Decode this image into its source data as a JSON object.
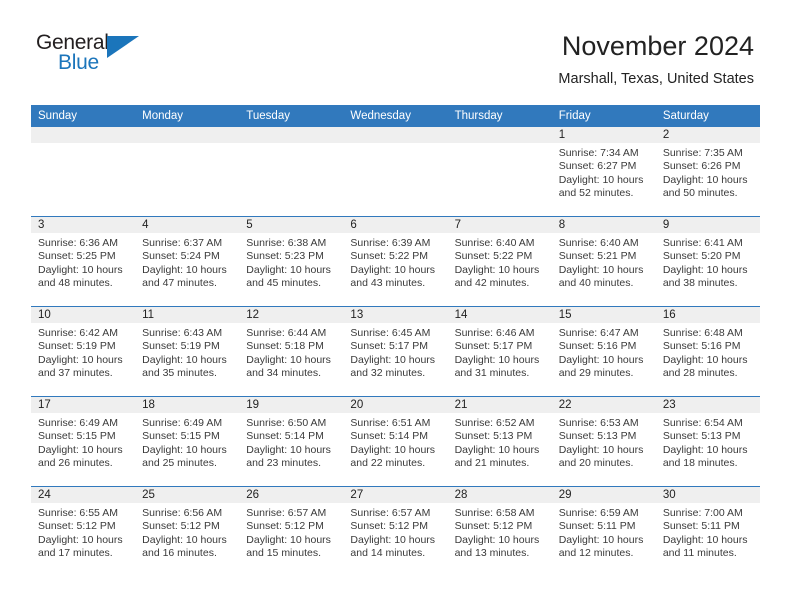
{
  "brand": {
    "name_part1": "General",
    "name_part2": "Blue",
    "mark": "triangle-logo-mark"
  },
  "header": {
    "title": "November 2024",
    "location": "Marshall, Texas, United States"
  },
  "colors": {
    "header_blue": "#3179bd",
    "day_band_gray": "#efefef",
    "brand_blue": "#1b75bb",
    "text": "#222222"
  },
  "weekday_headers": [
    "Sunday",
    "Monday",
    "Tuesday",
    "Wednesday",
    "Thursday",
    "Friday",
    "Saturday"
  ],
  "labels": {
    "sunrise_prefix": "Sunrise:",
    "sunset_prefix": "Sunset:",
    "daylight_prefix": "Daylight:"
  },
  "weeks": [
    [
      {
        "day": "",
        "empty": true
      },
      {
        "day": "",
        "empty": true
      },
      {
        "day": "",
        "empty": true
      },
      {
        "day": "",
        "empty": true
      },
      {
        "day": "",
        "empty": true
      },
      {
        "day": "1",
        "sunrise": "Sunrise: 7:34 AM",
        "sunset": "Sunset: 6:27 PM",
        "daylight_line1": "Daylight: 10 hours",
        "daylight_line2": "and 52 minutes."
      },
      {
        "day": "2",
        "sunrise": "Sunrise: 7:35 AM",
        "sunset": "Sunset: 6:26 PM",
        "daylight_line1": "Daylight: 10 hours",
        "daylight_line2": "and 50 minutes."
      }
    ],
    [
      {
        "day": "3",
        "sunrise": "Sunrise: 6:36 AM",
        "sunset": "Sunset: 5:25 PM",
        "daylight_line1": "Daylight: 10 hours",
        "daylight_line2": "and 48 minutes."
      },
      {
        "day": "4",
        "sunrise": "Sunrise: 6:37 AM",
        "sunset": "Sunset: 5:24 PM",
        "daylight_line1": "Daylight: 10 hours",
        "daylight_line2": "and 47 minutes."
      },
      {
        "day": "5",
        "sunrise": "Sunrise: 6:38 AM",
        "sunset": "Sunset: 5:23 PM",
        "daylight_line1": "Daylight: 10 hours",
        "daylight_line2": "and 45 minutes."
      },
      {
        "day": "6",
        "sunrise": "Sunrise: 6:39 AM",
        "sunset": "Sunset: 5:22 PM",
        "daylight_line1": "Daylight: 10 hours",
        "daylight_line2": "and 43 minutes."
      },
      {
        "day": "7",
        "sunrise": "Sunrise: 6:40 AM",
        "sunset": "Sunset: 5:22 PM",
        "daylight_line1": "Daylight: 10 hours",
        "daylight_line2": "and 42 minutes."
      },
      {
        "day": "8",
        "sunrise": "Sunrise: 6:40 AM",
        "sunset": "Sunset: 5:21 PM",
        "daylight_line1": "Daylight: 10 hours",
        "daylight_line2": "and 40 minutes."
      },
      {
        "day": "9",
        "sunrise": "Sunrise: 6:41 AM",
        "sunset": "Sunset: 5:20 PM",
        "daylight_line1": "Daylight: 10 hours",
        "daylight_line2": "and 38 minutes."
      }
    ],
    [
      {
        "day": "10",
        "sunrise": "Sunrise: 6:42 AM",
        "sunset": "Sunset: 5:19 PM",
        "daylight_line1": "Daylight: 10 hours",
        "daylight_line2": "and 37 minutes."
      },
      {
        "day": "11",
        "sunrise": "Sunrise: 6:43 AM",
        "sunset": "Sunset: 5:19 PM",
        "daylight_line1": "Daylight: 10 hours",
        "daylight_line2": "and 35 minutes."
      },
      {
        "day": "12",
        "sunrise": "Sunrise: 6:44 AM",
        "sunset": "Sunset: 5:18 PM",
        "daylight_line1": "Daylight: 10 hours",
        "daylight_line2": "and 34 minutes."
      },
      {
        "day": "13",
        "sunrise": "Sunrise: 6:45 AM",
        "sunset": "Sunset: 5:17 PM",
        "daylight_line1": "Daylight: 10 hours",
        "daylight_line2": "and 32 minutes."
      },
      {
        "day": "14",
        "sunrise": "Sunrise: 6:46 AM",
        "sunset": "Sunset: 5:17 PM",
        "daylight_line1": "Daylight: 10 hours",
        "daylight_line2": "and 31 minutes."
      },
      {
        "day": "15",
        "sunrise": "Sunrise: 6:47 AM",
        "sunset": "Sunset: 5:16 PM",
        "daylight_line1": "Daylight: 10 hours",
        "daylight_line2": "and 29 minutes."
      },
      {
        "day": "16",
        "sunrise": "Sunrise: 6:48 AM",
        "sunset": "Sunset: 5:16 PM",
        "daylight_line1": "Daylight: 10 hours",
        "daylight_line2": "and 28 minutes."
      }
    ],
    [
      {
        "day": "17",
        "sunrise": "Sunrise: 6:49 AM",
        "sunset": "Sunset: 5:15 PM",
        "daylight_line1": "Daylight: 10 hours",
        "daylight_line2": "and 26 minutes."
      },
      {
        "day": "18",
        "sunrise": "Sunrise: 6:49 AM",
        "sunset": "Sunset: 5:15 PM",
        "daylight_line1": "Daylight: 10 hours",
        "daylight_line2": "and 25 minutes."
      },
      {
        "day": "19",
        "sunrise": "Sunrise: 6:50 AM",
        "sunset": "Sunset: 5:14 PM",
        "daylight_line1": "Daylight: 10 hours",
        "daylight_line2": "and 23 minutes."
      },
      {
        "day": "20",
        "sunrise": "Sunrise: 6:51 AM",
        "sunset": "Sunset: 5:14 PM",
        "daylight_line1": "Daylight: 10 hours",
        "daylight_line2": "and 22 minutes."
      },
      {
        "day": "21",
        "sunrise": "Sunrise: 6:52 AM",
        "sunset": "Sunset: 5:13 PM",
        "daylight_line1": "Daylight: 10 hours",
        "daylight_line2": "and 21 minutes."
      },
      {
        "day": "22",
        "sunrise": "Sunrise: 6:53 AM",
        "sunset": "Sunset: 5:13 PM",
        "daylight_line1": "Daylight: 10 hours",
        "daylight_line2": "and 20 minutes."
      },
      {
        "day": "23",
        "sunrise": "Sunrise: 6:54 AM",
        "sunset": "Sunset: 5:13 PM",
        "daylight_line1": "Daylight: 10 hours",
        "daylight_line2": "and 18 minutes."
      }
    ],
    [
      {
        "day": "24",
        "sunrise": "Sunrise: 6:55 AM",
        "sunset": "Sunset: 5:12 PM",
        "daylight_line1": "Daylight: 10 hours",
        "daylight_line2": "and 17 minutes."
      },
      {
        "day": "25",
        "sunrise": "Sunrise: 6:56 AM",
        "sunset": "Sunset: 5:12 PM",
        "daylight_line1": "Daylight: 10 hours",
        "daylight_line2": "and 16 minutes."
      },
      {
        "day": "26",
        "sunrise": "Sunrise: 6:57 AM",
        "sunset": "Sunset: 5:12 PM",
        "daylight_line1": "Daylight: 10 hours",
        "daylight_line2": "and 15 minutes."
      },
      {
        "day": "27",
        "sunrise": "Sunrise: 6:57 AM",
        "sunset": "Sunset: 5:12 PM",
        "daylight_line1": "Daylight: 10 hours",
        "daylight_line2": "and 14 minutes."
      },
      {
        "day": "28",
        "sunrise": "Sunrise: 6:58 AM",
        "sunset": "Sunset: 5:12 PM",
        "daylight_line1": "Daylight: 10 hours",
        "daylight_line2": "and 13 minutes."
      },
      {
        "day": "29",
        "sunrise": "Sunrise: 6:59 AM",
        "sunset": "Sunset: 5:11 PM",
        "daylight_line1": "Daylight: 10 hours",
        "daylight_line2": "and 12 minutes."
      },
      {
        "day": "30",
        "sunrise": "Sunrise: 7:00 AM",
        "sunset": "Sunset: 5:11 PM",
        "daylight_line1": "Daylight: 10 hours",
        "daylight_line2": "and 11 minutes."
      }
    ]
  ]
}
